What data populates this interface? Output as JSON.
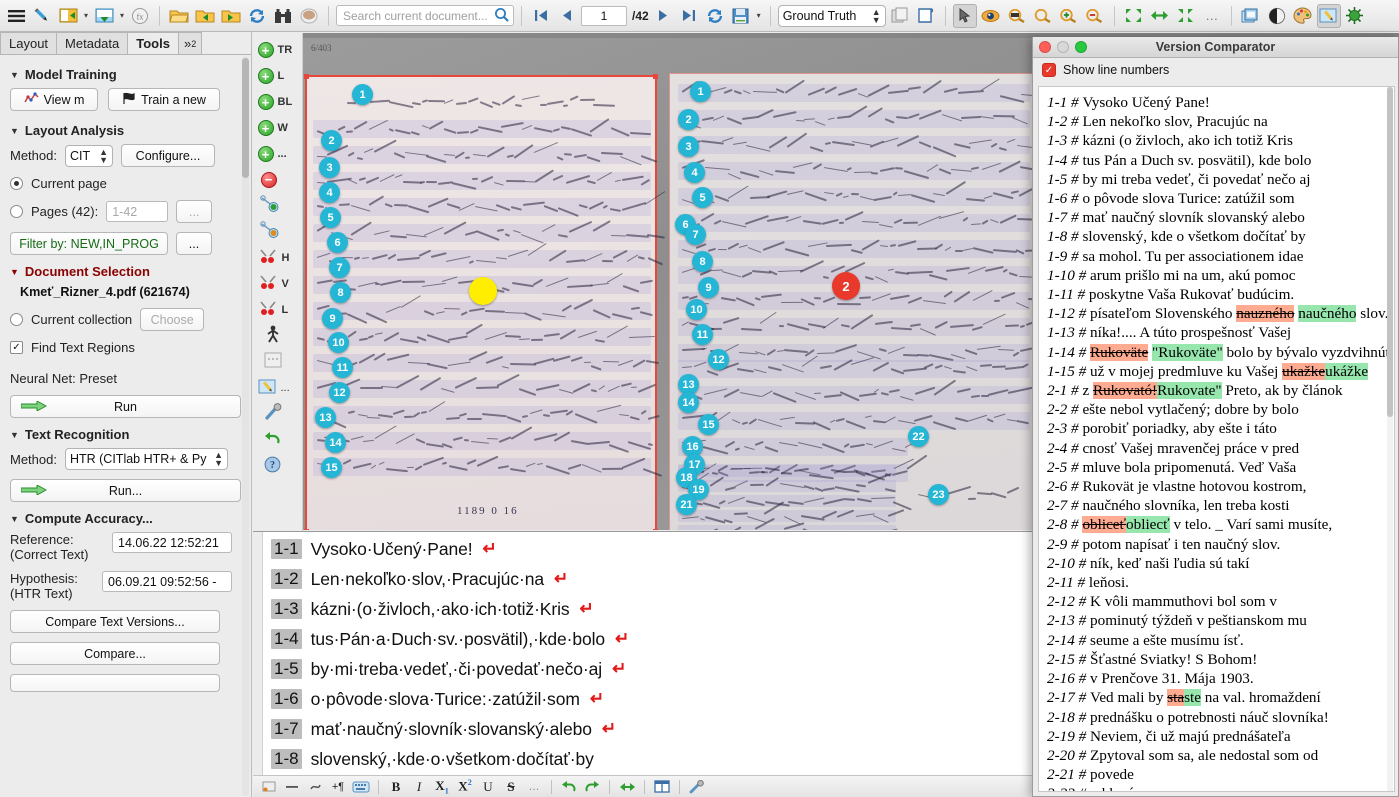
{
  "app": {
    "toolbar": {
      "search_placeholder": "Search current document...",
      "page_current": "1",
      "page_total": "/42",
      "version_select": "Ground Truth",
      "icons": [
        "menu-icon",
        "pen-icon",
        "open-collection-icon",
        "export-document-icon",
        "metrics-icon",
        "open-folder-icon",
        "import-folder-icon",
        "export-folder-icon",
        "reload-icon",
        "search-documents-icon",
        "coffee-icon",
        "search-icon",
        "first-page-icon",
        "previous-page-icon",
        "next-page-icon",
        "last-page-icon",
        "refresh-page-icon",
        "save-icon",
        "duplicate-icon",
        "page-view-icon",
        "select-tool-icon",
        "eye-icon",
        "fit-width-icon",
        "zoom-icon",
        "zoom-in-icon",
        "zoom-out-icon",
        "collapse-icon",
        "fit-horizontal-icon",
        "expand-icon",
        "overflow-icon",
        "layers-icon",
        "contrast-icon",
        "palette-icon",
        "edit-mode-icon",
        "virus-icon"
      ]
    }
  },
  "sidebar": {
    "tabs": [
      {
        "label": "Layout",
        "active": false
      },
      {
        "label": "Metadata",
        "active": false
      },
      {
        "label": "Tools",
        "active": true
      },
      {
        "label": "»",
        "sub": "2",
        "active": false
      }
    ],
    "model_training": {
      "title": "Model Training",
      "view_models_label": "View m",
      "train_new_label": "Train a new "
    },
    "layout_analysis": {
      "title": "Layout Analysis",
      "method_label": "Method:",
      "method_value": "CIT",
      "configure_label": "Configure...",
      "current_page_label": "Current page",
      "current_page_selected": true,
      "pages_label": "Pages (42):",
      "pages_placeholder": "1-42",
      "pages_more_label": "...",
      "filter_label": "Filter by: NEW,IN_PROG",
      "filter_more_label": "..."
    },
    "document_selection": {
      "title": "Document Selection",
      "document_name": "Kmeť_Rizner_4.pdf (621674)",
      "current_collection_label": "Current collection",
      "current_collection_selected": false,
      "choose_label": "Choose",
      "find_text_regions_label": "Find Text Regions",
      "find_text_regions_checked": true,
      "neural_net_label": "Neural Net: Preset",
      "run_label": "Run"
    },
    "text_recognition": {
      "title": "Text Recognition",
      "method_label": "Method:",
      "method_value": "HTR (CITlab HTR+ & Py",
      "run_label": "Run..."
    },
    "compute_accuracy": {
      "title": "Compute Accuracy...",
      "reference_label_line1": "Reference:",
      "reference_label_line2": "(Correct Text)",
      "reference_value": "14.06.22 12:52:21",
      "hypothesis_label_line1": "Hypothesis:",
      "hypothesis_label_line2": "(HTR Text)",
      "hypothesis_value": "06.09.21 09:52:56 -",
      "compare_text_versions_label": "Compare Text Versions...",
      "compare_label": "Compare..."
    }
  },
  "canvas_tools": [
    {
      "icon": "add-text-region-icon",
      "label": "TR"
    },
    {
      "icon": "add-line-icon",
      "label": "L"
    },
    {
      "icon": "add-baseline-icon",
      "label": "BL"
    },
    {
      "icon": "add-word-icon",
      "label": "W"
    },
    {
      "icon": "add-more-icon",
      "label": "..."
    },
    {
      "icon": "delete-icon",
      "label": ""
    },
    {
      "icon": "add-shape-point-icon",
      "label": ""
    },
    {
      "icon": "remove-shape-point-icon",
      "label": ""
    },
    {
      "icon": "split-horizontal-icon",
      "label": "H"
    },
    {
      "icon": "split-vertical-icon",
      "label": "V"
    },
    {
      "icon": "split-line-icon",
      "label": "L"
    },
    {
      "icon": "person-icon",
      "label": ""
    },
    {
      "icon": "table-icon",
      "label": ""
    },
    {
      "icon": "edit-icon",
      "label": "..."
    },
    {
      "icon": "wrench-icon",
      "label": ""
    },
    {
      "icon": "undo-icon",
      "label": ""
    },
    {
      "icon": "help-icon",
      "label": ""
    }
  ],
  "image": {
    "archive_number": "6/403",
    "page_code": "1189 0 16",
    "left_page_markers": [
      "1",
      "2",
      "3",
      "4",
      "5",
      "6",
      "7",
      "8",
      "9",
      "10",
      "11",
      "12",
      "13",
      "14",
      "15"
    ],
    "left_page_highlight_markers": [
      {
        "label": "1",
        "color": "#ffee00"
      }
    ],
    "right_page_markers": [
      "1",
      "2",
      "3",
      "4",
      "5",
      "6",
      "7",
      "8",
      "9",
      "10",
      "11",
      "12",
      "13",
      "14",
      "15",
      "16",
      "17",
      "18",
      "19",
      "21",
      "22",
      "23"
    ],
    "right_page_highlight_markers": [
      {
        "label": "2",
        "color": "#e8392c"
      }
    ]
  },
  "transcription": {
    "lines": [
      {
        "num": "1-1",
        "text": "Vysoko·Učený·Pane!",
        "cr": true
      },
      {
        "num": "1-2",
        "text": "Len·nekoľko·slov,·Pracujúc·na",
        "cr": true
      },
      {
        "num": "1-3",
        "text": "kázni·(o·živloch,·ako·ich·totiž·Kris",
        "cr": true
      },
      {
        "num": "1-4",
        "text": "tus·Pán·a·Duch·sv.·posvätil),·kde·bolo",
        "cr": true
      },
      {
        "num": "1-5",
        "text": "by·mi·treba·vedeť,·či·povedať·nečo·aj",
        "cr": true
      },
      {
        "num": "1-6",
        "text": "o·pôvode·slova·Turice:·zatúžil·som",
        "cr": true
      },
      {
        "num": "1-7",
        "text": "mať·naučný·slovník·slovanský·alebo",
        "cr": true
      },
      {
        "num": "1-8",
        "text": "slovenský,·kde·o·všetkom·dočítať·by",
        "cr": false
      }
    ],
    "toolbar_icons": [
      "insert-tag-icon",
      "dash-icon",
      "unclear-icon",
      "pilcrow-icon",
      "keyboard-icon",
      "bold-icon",
      "italic-icon",
      "subscript-icon",
      "superscript-icon",
      "underline-icon",
      "strikethrough-icon",
      "more-icon",
      "undo-icon",
      "redo-icon",
      "sync-icon",
      "columns-icon",
      "wrench-icon"
    ]
  },
  "version_comparator": {
    "title": "Version Comparator",
    "show_line_numbers_label": "Show line numbers",
    "show_line_numbers_checked": true,
    "colors": {
      "deleted": "#ffab91",
      "inserted": "#96e6ae"
    },
    "lines": [
      {
        "num": "1-1",
        "parts": [
          {
            "t": "Vysoko Učený Pane!"
          }
        ]
      },
      {
        "num": "1-2",
        "parts": [
          {
            "t": "Len nekoľko slov, Pracujúc na"
          }
        ]
      },
      {
        "num": "1-3",
        "parts": [
          {
            "t": "kázni (o živloch, ako ich totiž Kris"
          }
        ]
      },
      {
        "num": "1-4",
        "parts": [
          {
            "t": "tus Pán a Duch sv. posvätil), kde bolo"
          }
        ]
      },
      {
        "num": "1-5",
        "parts": [
          {
            "t": "by mi treba vedeť, či povedať nečo aj"
          }
        ]
      },
      {
        "num": "1-6",
        "parts": [
          {
            "t": "o pôvode slova Turice: zatúžil som"
          }
        ]
      },
      {
        "num": "1-7",
        "parts": [
          {
            "t": "mať naučný slovník slovanský alebo"
          }
        ]
      },
      {
        "num": "1-8",
        "parts": [
          {
            "t": "slovenský, kde o všetkom dočítať by"
          }
        ]
      },
      {
        "num": "1-9",
        "parts": [
          {
            "t": "sa mohol. Tu per associationem idae"
          }
        ]
      },
      {
        "num": "1-10",
        "parts": [
          {
            "t": "arum prišlo mi na um, akú pomoc"
          }
        ]
      },
      {
        "num": "1-11",
        "parts": [
          {
            "t": "poskytne Vaša Rukovať budúcim."
          }
        ]
      },
      {
        "num": "1-12",
        "parts": [
          {
            "t": "písateľom Slovenského "
          },
          {
            "t": "nauzného",
            "s": "del"
          },
          {
            "t": " "
          },
          {
            "t": "naučného",
            "s": "ins"
          },
          {
            "t": " slov."
          }
        ]
      },
      {
        "num": "1-13",
        "parts": [
          {
            "t": "níka!.... A túto prospešnosť Vašej"
          }
        ]
      },
      {
        "num": "1-14",
        "parts": [
          {
            "t": "Rukoväte",
            "s": "del"
          },
          {
            "t": " "
          },
          {
            "t": "\"Rukoväte\"",
            "s": "ins"
          },
          {
            "t": " bolo by bývalo vyzdvihnúť"
          }
        ]
      },
      {
        "num": "1-15",
        "parts": [
          {
            "t": "už v mojej predmluve ku Vašej "
          },
          {
            "t": "ukažke",
            "s": "del"
          },
          {
            "t": "ukážke",
            "s": "ins"
          }
        ]
      },
      {
        "num": "2-1",
        "parts": [
          {
            "t": "z "
          },
          {
            "t": "Rukovató!",
            "s": "del"
          },
          {
            "t": "Rukovate\"",
            "s": "ins"
          },
          {
            "t": " Preto, ak by článok"
          }
        ]
      },
      {
        "num": "2-2",
        "parts": [
          {
            "t": "ešte nebol vytlačený; dobre by bolo"
          }
        ]
      },
      {
        "num": "2-3",
        "parts": [
          {
            "t": "porobiť poriadky, aby ešte i táto"
          }
        ]
      },
      {
        "num": "2-4",
        "parts": [
          {
            "t": "cnosť Vašej mravenčej práce v pred"
          }
        ]
      },
      {
        "num": "2-5",
        "parts": [
          {
            "t": "mluve bola pripomenutá. Veď Vaša"
          }
        ]
      },
      {
        "num": "2-6",
        "parts": [
          {
            "t": "Rukovät je vlastne hotovou kostrom,"
          }
        ]
      },
      {
        "num": "2-7",
        "parts": [
          {
            "t": "naučného slovníka, len treba kosti"
          }
        ]
      },
      {
        "num": "2-8",
        "parts": [
          {
            "t": "obliceť",
            "s": "del"
          },
          {
            "t": "obliecť",
            "s": "ins"
          },
          {
            "t": " v telo. _ Varí sami musíte,"
          }
        ]
      },
      {
        "num": "2-9",
        "parts": [
          {
            "t": "potom napísať i ten naučný slov."
          }
        ]
      },
      {
        "num": "2-10",
        "parts": [
          {
            "t": "ník, keď naši ľudia sú takí"
          }
        ]
      },
      {
        "num": "2-11",
        "parts": [
          {
            "t": "leňosi."
          }
        ]
      },
      {
        "num": "2-12",
        "parts": [
          {
            "t": "K vôli mammuthovi bol som v"
          }
        ]
      },
      {
        "num": "2-13",
        "parts": [
          {
            "t": "pominutý týždeň v peštianskom mu"
          }
        ]
      },
      {
        "num": "2-14",
        "parts": [
          {
            "t": "seume a ešte musímu ísť."
          }
        ]
      },
      {
        "num": "2-15",
        "parts": [
          {
            "t": "Šťastné Sviatky! S Bohom!"
          }
        ]
      },
      {
        "num": "2-16",
        "parts": [
          {
            "t": "v Prenčove 31. Mája 1903."
          }
        ]
      },
      {
        "num": "2-17",
        "parts": [
          {
            "t": "Ved mali by "
          },
          {
            "t": "sta",
            "s": "del"
          },
          {
            "t": "ste",
            "s": "ins"
          },
          {
            "t": " na val. hromaždení"
          }
        ]
      },
      {
        "num": "2-18",
        "parts": [
          {
            "t": "prednášku o potrebnosti náuč slovníka!"
          }
        ]
      },
      {
        "num": "2-19",
        "parts": [
          {
            "t": "Neviem, či už majú prednášateľa"
          }
        ]
      },
      {
        "num": "2-20",
        "parts": [
          {
            "t": "Zpytoval som sa, ale nedostal som od"
          }
        ]
      },
      {
        "num": "2-21",
        "parts": [
          {
            "t": "povede"
          }
        ]
      },
      {
        "num": "2-22",
        "parts": [
          {
            "t": "oddaný"
          }
        ]
      }
    ]
  }
}
